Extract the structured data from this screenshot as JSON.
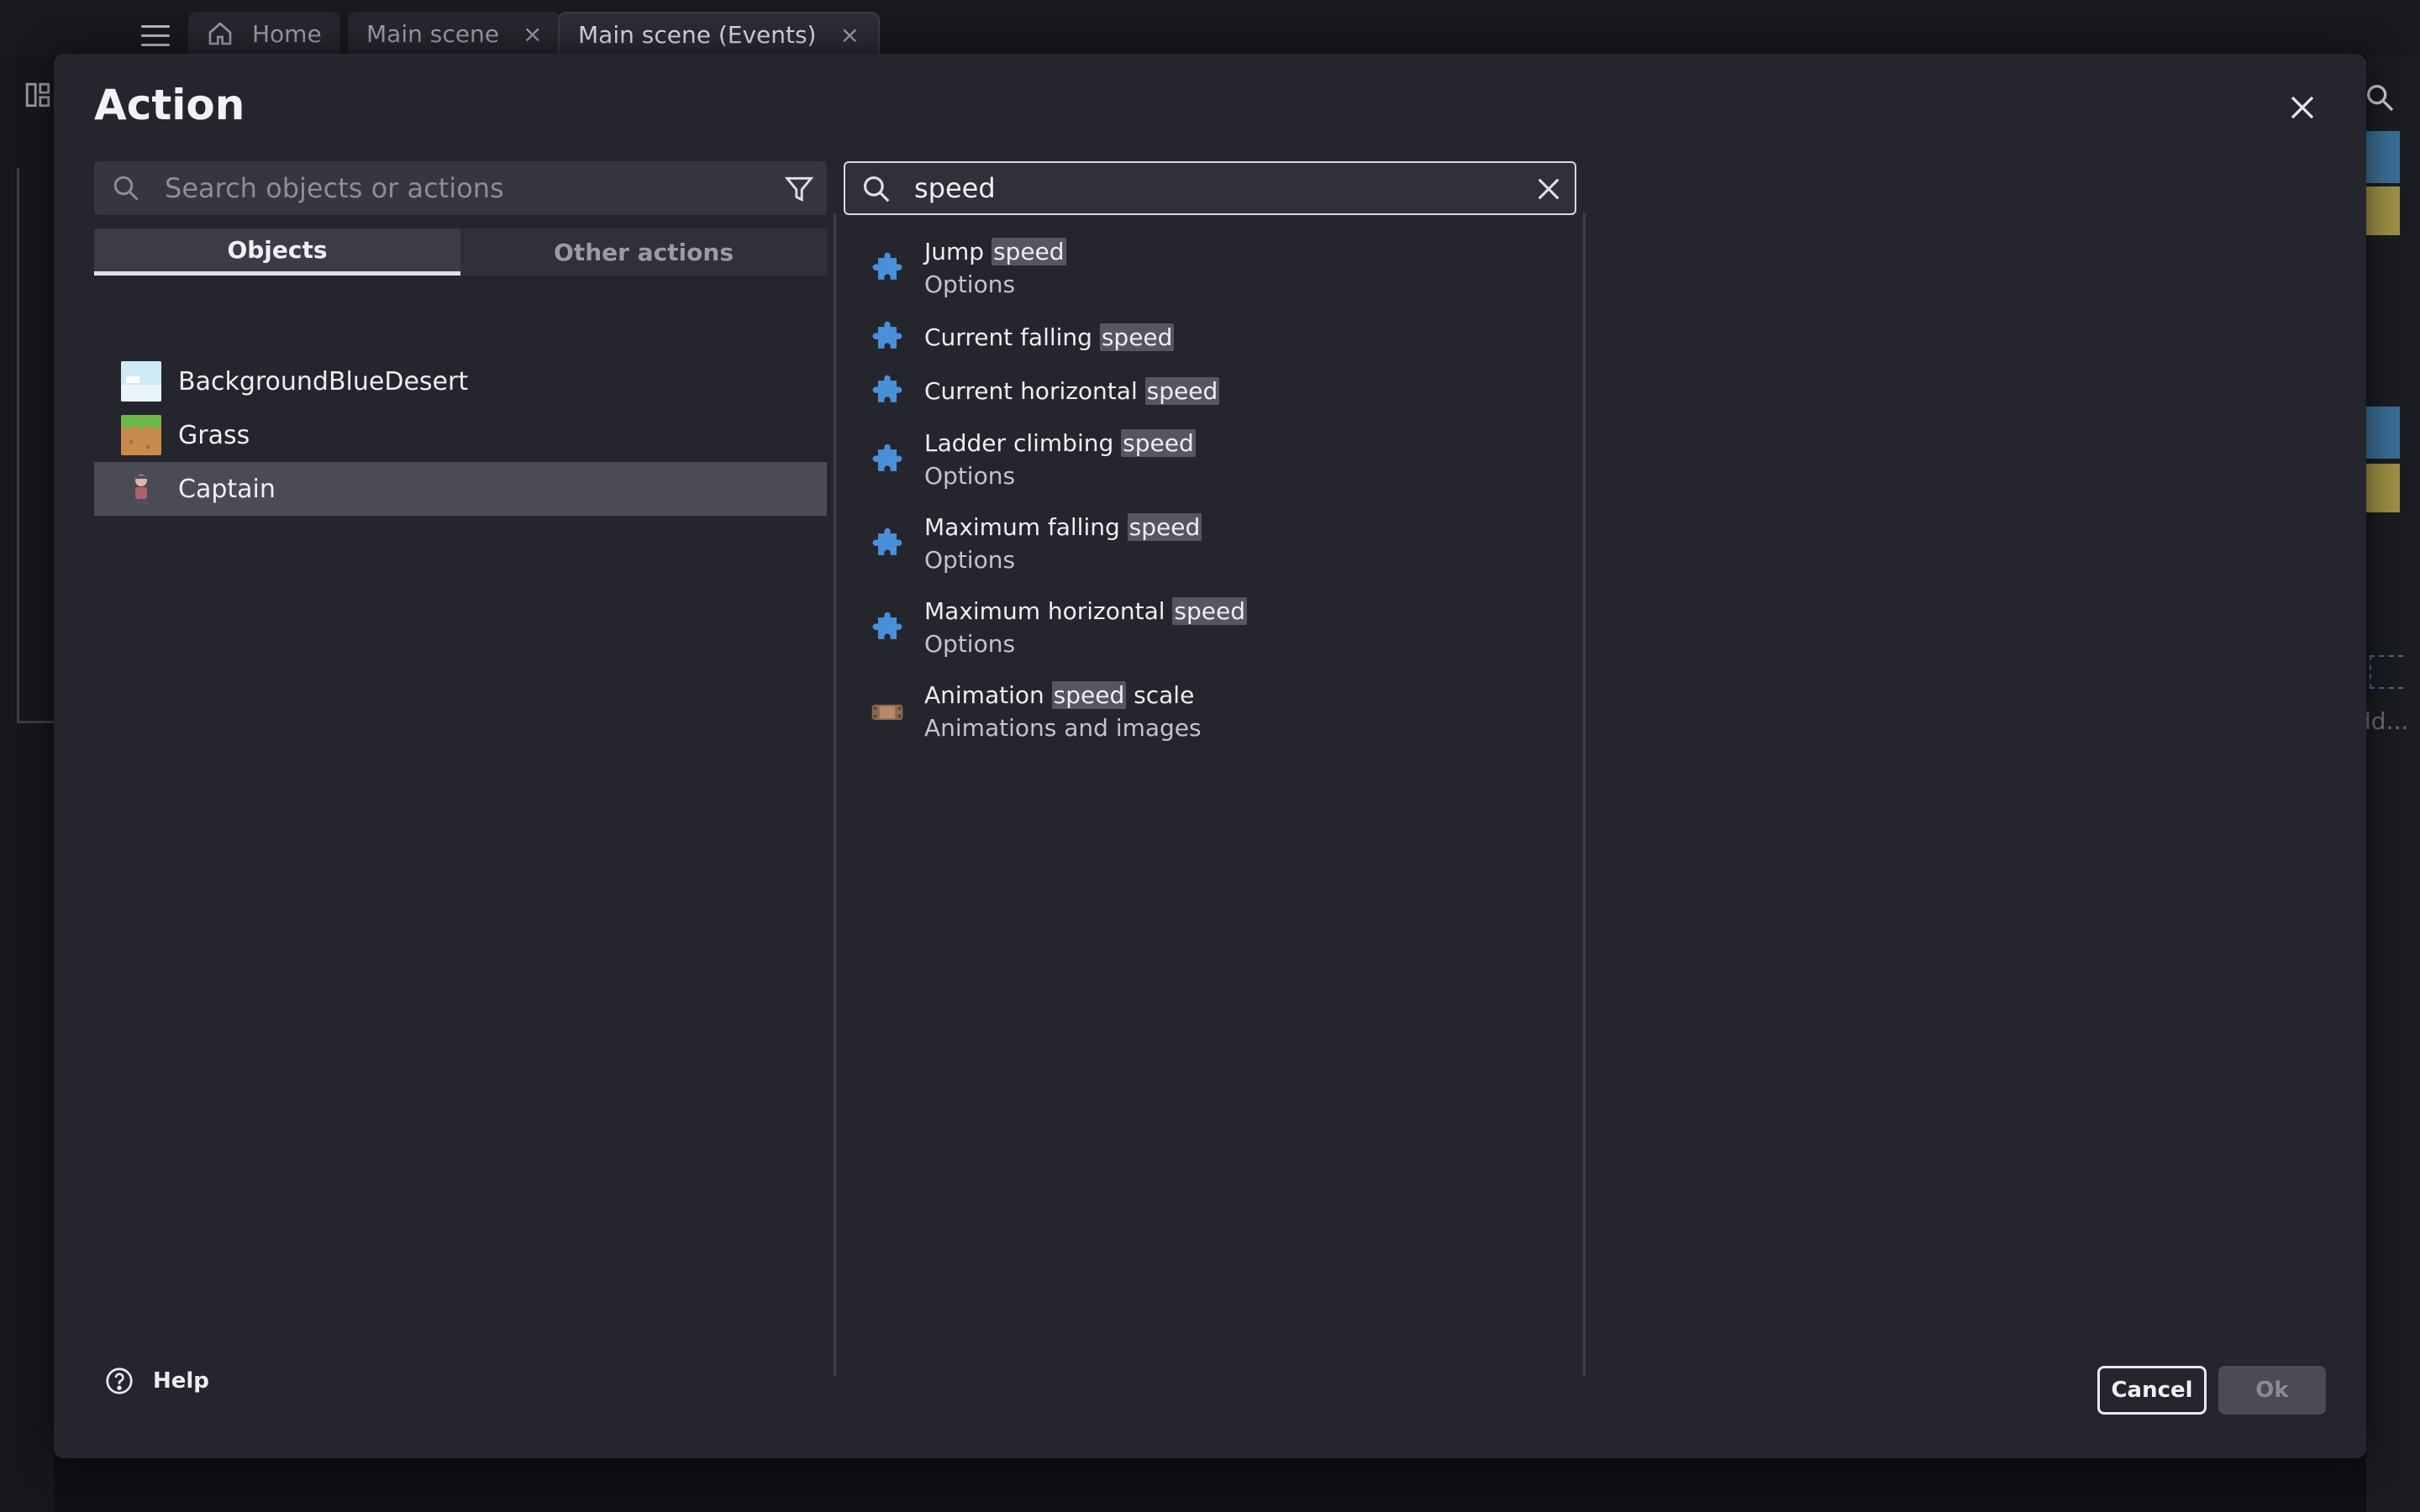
{
  "tabs": [
    {
      "label": "Home",
      "closable": false
    },
    {
      "label": "Main scene",
      "closable": true,
      "close_glyph": "×"
    },
    {
      "label": "Main scene (Events)",
      "closable": true,
      "active": true,
      "close_glyph": "×"
    }
  ],
  "background": {
    "add_text": "dd..."
  },
  "dialog": {
    "title": "Action",
    "object_search": {
      "value": "",
      "placeholder": "Search objects or actions"
    },
    "object_tabs": [
      {
        "label": "Objects",
        "active": true
      },
      {
        "label": "Other actions",
        "active": false
      }
    ],
    "objects": [
      {
        "name": "BackgroundBlueDesert",
        "thumb": "background-thumb-icon",
        "selected": false
      },
      {
        "name": "Grass",
        "thumb": "grass-thumb-icon",
        "selected": false
      },
      {
        "name": "Captain",
        "thumb": "captain-thumb-icon",
        "selected": true
      }
    ],
    "action_search": {
      "value": "speed",
      "placeholder": ""
    },
    "actions": [
      {
        "pre": "Jump ",
        "hl": "speed",
        "post": "",
        "group": "Options",
        "icon": "puzzle-extension-icon"
      },
      {
        "pre": "Current falling ",
        "hl": "speed",
        "post": "",
        "group": "",
        "icon": "puzzle-extension-icon"
      },
      {
        "pre": "Current horizontal ",
        "hl": "speed",
        "post": "",
        "group": "",
        "icon": "puzzle-extension-icon"
      },
      {
        "pre": "Ladder climbing ",
        "hl": "speed",
        "post": "",
        "group": "Options",
        "icon": "puzzle-extension-icon"
      },
      {
        "pre": "Maximum falling ",
        "hl": "speed",
        "post": "",
        "group": "Options",
        "icon": "puzzle-extension-icon"
      },
      {
        "pre": "Maximum horizontal ",
        "hl": "speed",
        "post": "",
        "group": "Options",
        "icon": "puzzle-extension-icon"
      },
      {
        "pre": "Animation ",
        "hl": "speed",
        "post": " scale",
        "group": "Animations and images",
        "icon": "animation-film-icon"
      }
    ],
    "footer": {
      "help_label": "Help",
      "cancel_label": "Cancel",
      "ok_label": "Ok"
    }
  },
  "colors": {
    "puzzle_icon": "#4a90d9",
    "highlight_bg": "#55565f",
    "dialog_bg": "#25262d"
  }
}
